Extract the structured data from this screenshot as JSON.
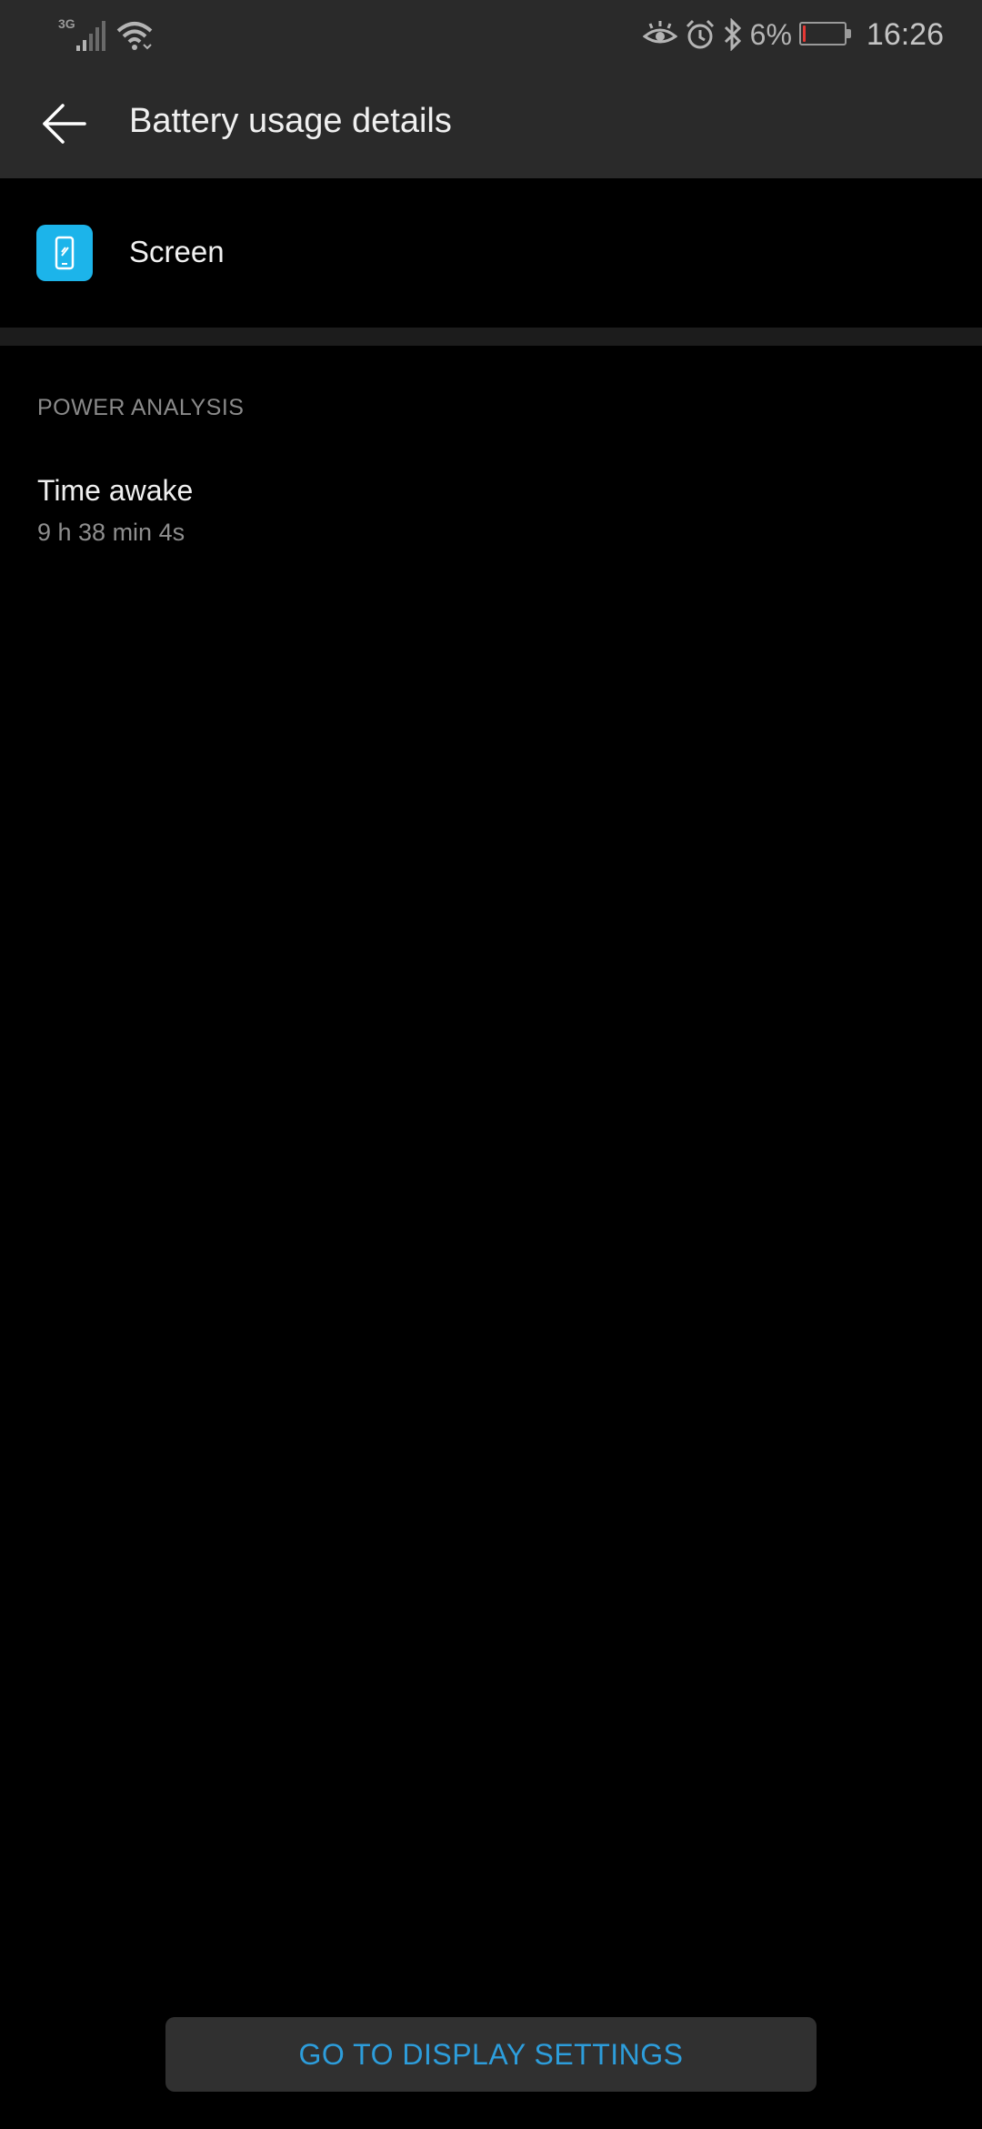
{
  "status_bar": {
    "network_type": "3G",
    "battery_percent": "6%",
    "time": "16:26",
    "icons": [
      "signal-icon",
      "wifi-icon",
      "eye-comfort-icon",
      "alarm-icon",
      "bluetooth-icon",
      "battery-icon"
    ],
    "battery_level": 0.06,
    "battery_color": "#e53935"
  },
  "app_bar": {
    "back_icon": "arrow-left-icon",
    "title": "Battery usage details"
  },
  "app": {
    "icon": "screen-phone-icon",
    "icon_color": "#1cb4ea",
    "name": "Screen"
  },
  "power_analysis": {
    "section_title": "POWER ANALYSIS",
    "time_awake_label": "Time awake",
    "time_awake_value": "9 h 38 min 4s"
  },
  "footer": {
    "button_label": "GO TO DISPLAY SETTINGS",
    "button_color": "#2d9ddb"
  }
}
